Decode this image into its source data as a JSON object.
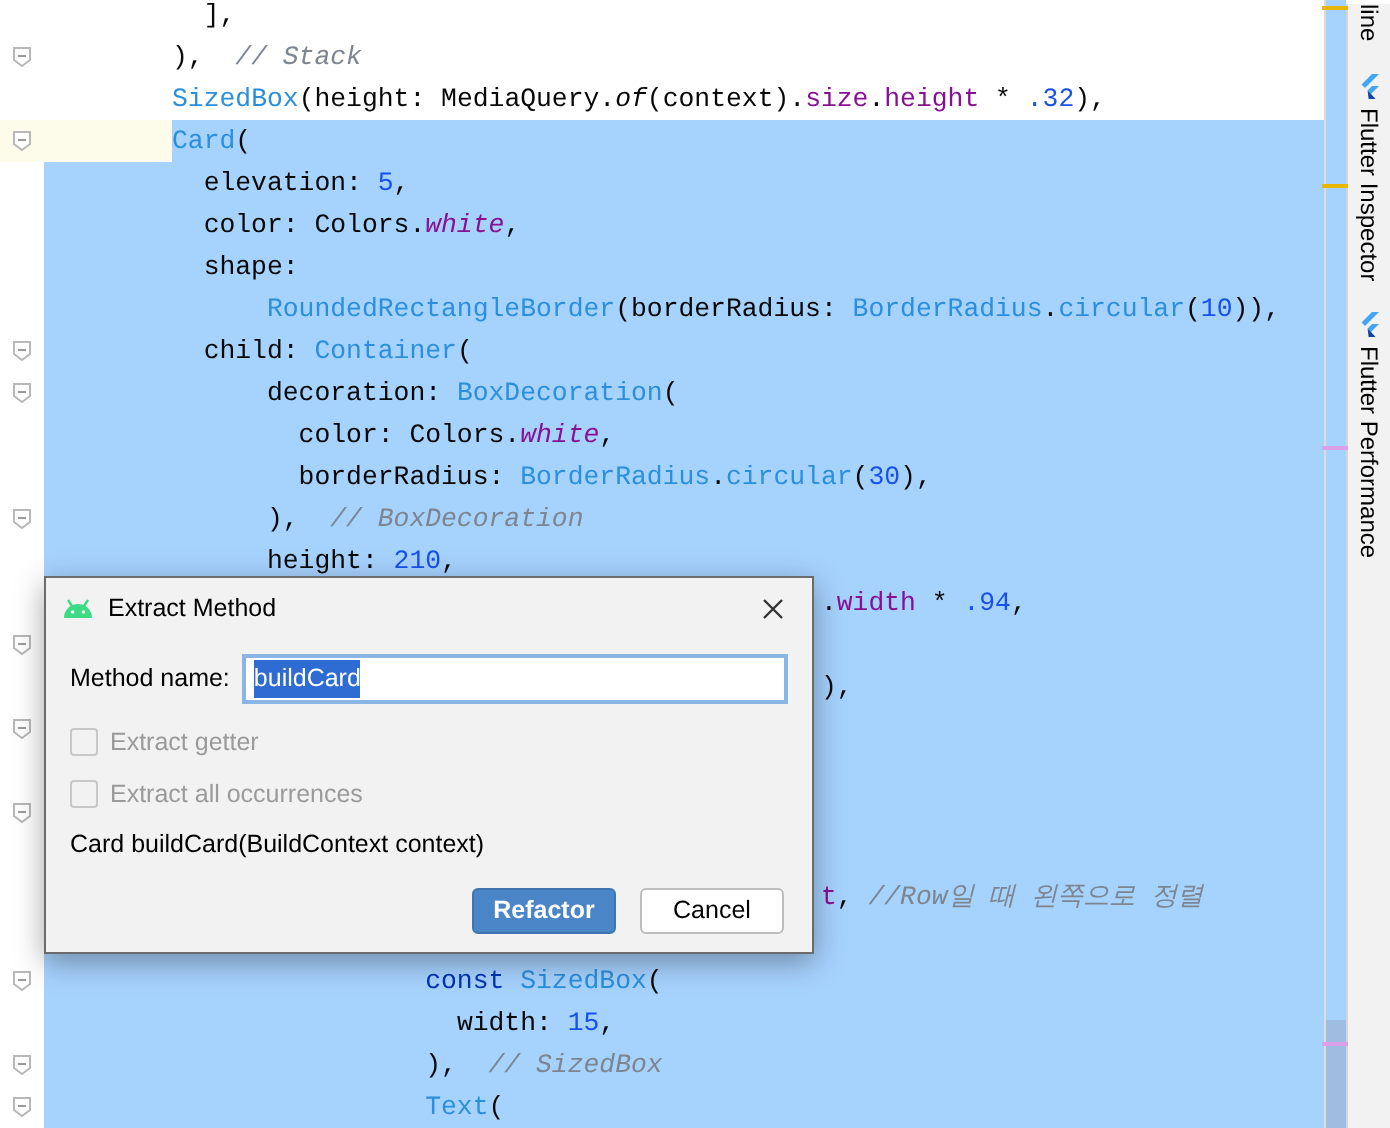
{
  "editor": {
    "lines": [
      {
        "fold": false,
        "selected": false,
        "tokens": [
          {
            "text": "],",
            "kind": "plain"
          }
        ]
      },
      {
        "fold": true,
        "selected": false,
        "tokens": [
          {
            "text": "),  ",
            "kind": "plain"
          },
          {
            "text": "// Stack",
            "kind": "comment"
          }
        ]
      },
      {
        "fold": false,
        "selected": false,
        "tokens": [
          {
            "text": "SizedBox",
            "kind": "type"
          },
          {
            "text": "(height: MediaQuery.",
            "kind": "plain"
          },
          {
            "text": "of",
            "kind": "static"
          },
          {
            "text": "(context).",
            "kind": "plain"
          },
          {
            "text": "size",
            "kind": "property"
          },
          {
            "text": ".",
            "kind": "plain"
          },
          {
            "text": "height",
            "kind": "property"
          },
          {
            "text": " * ",
            "kind": "plain"
          },
          {
            "text": ".32",
            "kind": "number"
          },
          {
            "text": "),",
            "kind": "plain"
          }
        ]
      },
      {
        "fold": true,
        "selected": true,
        "tokens": [
          {
            "text": "Card",
            "kind": "type"
          },
          {
            "text": "(",
            "kind": "plain"
          }
        ]
      },
      {
        "fold": false,
        "selected": true,
        "tokens": [
          {
            "text": "elevation: ",
            "kind": "plain"
          },
          {
            "text": "5",
            "kind": "number"
          },
          {
            "text": ",",
            "kind": "plain"
          }
        ]
      },
      {
        "fold": false,
        "selected": true,
        "tokens": [
          {
            "text": "color: Colors.",
            "kind": "plain"
          },
          {
            "text": "white",
            "kind": "field"
          },
          {
            "text": ",",
            "kind": "plain"
          }
        ]
      },
      {
        "fold": false,
        "selected": true,
        "tokens": [
          {
            "text": "shape:",
            "kind": "plain"
          }
        ]
      },
      {
        "fold": false,
        "selected": true,
        "tokens": [
          {
            "text": "RoundedRectangleBorder",
            "kind": "type"
          },
          {
            "text": "(borderRadius: ",
            "kind": "plain"
          },
          {
            "text": "BorderRadius",
            "kind": "type"
          },
          {
            "text": ".",
            "kind": "plain"
          },
          {
            "text": "circular",
            "kind": "type"
          },
          {
            "text": "(",
            "kind": "plain"
          },
          {
            "text": "10",
            "kind": "number"
          },
          {
            "text": ")),",
            "kind": "plain"
          }
        ]
      },
      {
        "fold": true,
        "selected": true,
        "tokens": [
          {
            "text": "child: ",
            "kind": "plain"
          },
          {
            "text": "Container",
            "kind": "type"
          },
          {
            "text": "(",
            "kind": "plain"
          }
        ]
      },
      {
        "fold": true,
        "selected": true,
        "tokens": [
          {
            "text": "decoration: ",
            "kind": "plain"
          },
          {
            "text": "BoxDecoration",
            "kind": "type"
          },
          {
            "text": "(",
            "kind": "plain"
          }
        ]
      },
      {
        "fold": false,
        "selected": true,
        "tokens": [
          {
            "text": "color: Colors.",
            "kind": "plain"
          },
          {
            "text": "white",
            "kind": "field"
          },
          {
            "text": ",",
            "kind": "plain"
          }
        ]
      },
      {
        "fold": false,
        "selected": true,
        "tokens": [
          {
            "text": "borderRadius: ",
            "kind": "plain"
          },
          {
            "text": "BorderRadius",
            "kind": "type"
          },
          {
            "text": ".",
            "kind": "plain"
          },
          {
            "text": "circular",
            "kind": "type"
          },
          {
            "text": "(",
            "kind": "plain"
          },
          {
            "text": "30",
            "kind": "number"
          },
          {
            "text": "),",
            "kind": "plain"
          }
        ]
      },
      {
        "fold": true,
        "selected": true,
        "tokens": [
          {
            "text": "),  ",
            "kind": "plain"
          },
          {
            "text": "// BoxDecoration",
            "kind": "comment"
          }
        ]
      },
      {
        "fold": false,
        "selected": true,
        "tokens": [
          {
            "text": "height: ",
            "kind": "plain"
          },
          {
            "text": "210",
            "kind": "number"
          },
          {
            "text": ",",
            "kind": "plain"
          }
        ]
      },
      {
        "fold": false,
        "selected": true,
        "tokens": [
          {
            "text": ".",
            "kind": "plain"
          },
          {
            "text": "width",
            "kind": "property"
          },
          {
            "text": " * ",
            "kind": "plain"
          },
          {
            "text": ".94",
            "kind": "number"
          },
          {
            "text": ",",
            "kind": "plain"
          }
        ]
      },
      {
        "fold": true,
        "selected": true
      },
      {
        "fold": false,
        "selected": true,
        "tokens": [
          {
            "text": "),",
            "kind": "plain"
          }
        ]
      },
      {
        "fold": true,
        "selected": true
      },
      {
        "fold": false,
        "selected": true
      },
      {
        "fold": true,
        "selected": true
      },
      {
        "fold": false,
        "selected": true
      },
      {
        "fold": false,
        "selected": true,
        "tokens": [
          {
            "text": "t",
            "kind": "property"
          },
          {
            "text": ", ",
            "kind": "plain"
          },
          {
            "text": "//Row일 때 왼쪽으로 정렬",
            "kind": "comment"
          }
        ]
      },
      {
        "fold": false,
        "selected": true
      },
      {
        "fold": true,
        "selected": true,
        "tokens": [
          {
            "text": "const",
            "kind": "keyword"
          },
          {
            "text": " SizedBox",
            "kind": "type"
          },
          {
            "text": "(",
            "kind": "plain"
          }
        ]
      },
      {
        "fold": false,
        "selected": true,
        "tokens": [
          {
            "text": "width: ",
            "kind": "plain"
          },
          {
            "text": "15",
            "kind": "number"
          },
          {
            "text": ",",
            "kind": "plain"
          }
        ]
      },
      {
        "fold": true,
        "selected": true,
        "tokens": [
          {
            "text": "),  ",
            "kind": "plain"
          },
          {
            "text": "// SizedBox",
            "kind": "comment"
          }
        ]
      },
      {
        "fold": true,
        "selected": true,
        "tokens": [
          {
            "text": "Text",
            "kind": "type"
          },
          {
            "text": "(",
            "kind": "plain"
          }
        ]
      }
    ]
  },
  "tool_windows": [
    {
      "label": "line",
      "kind": "plain"
    },
    {
      "label": "Flutter Inspector",
      "kind": "flutter"
    },
    {
      "label": "Flutter Performance",
      "kind": "flutter"
    }
  ],
  "dialog": {
    "title": "Extract Method",
    "method_name_label": "Method name:",
    "method_name_value": "buildCard",
    "value_selected": true,
    "options": [
      {
        "label": "Extract getter",
        "checked": false,
        "disabled": true
      },
      {
        "label": "Extract all occurrences",
        "checked": false,
        "disabled": true
      }
    ],
    "signature": "Card buildCard(BuildContext context)",
    "buttons": [
      {
        "label": "Refactor",
        "kind": "primary"
      },
      {
        "label": "Cancel",
        "kind": "secondary"
      }
    ]
  }
}
